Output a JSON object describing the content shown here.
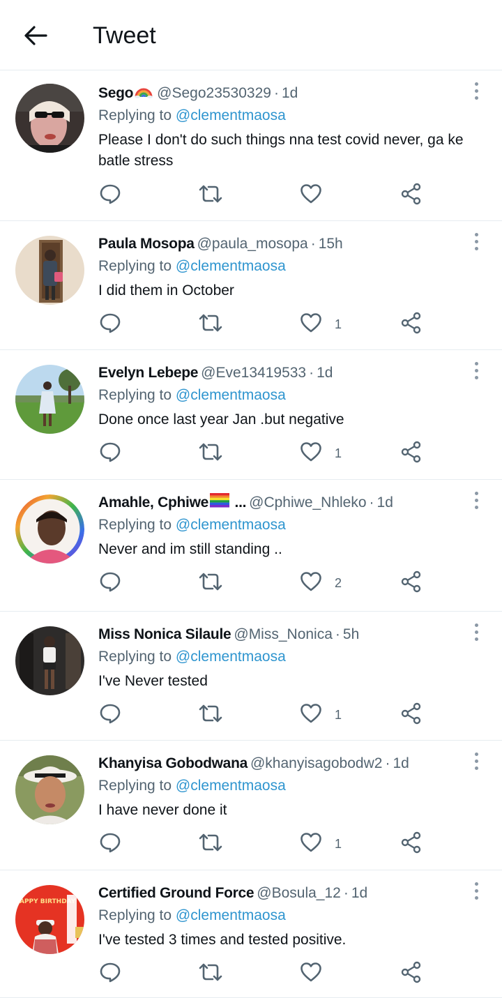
{
  "header": {
    "title": "Tweet"
  },
  "tweets": [
    {
      "name": "Sego",
      "emoji": "rainbow-emoji",
      "handle": "@Sego23530329",
      "time": "1d",
      "replying_prefix": "Replying to ",
      "replying_to": "@clementmaosa",
      "text": "Please I don't do such things nna test covid never, ga ke batle stress",
      "likes": ""
    },
    {
      "name": "Paula Mosopa",
      "emoji": "",
      "handle": "@paula_mosopa",
      "time": "15h",
      "replying_prefix": "Replying to ",
      "replying_to": "@clementmaosa",
      "text": "I did them in October",
      "likes": "1"
    },
    {
      "name": "Evelyn Lebepe",
      "emoji": "",
      "handle": "@Eve13419533",
      "time": "1d",
      "replying_prefix": "Replying to ",
      "replying_to": "@clementmaosa",
      "text": "Done once last year Jan .but negative",
      "likes": "1"
    },
    {
      "name": "Amahle, Cphiwe",
      "emoji": "rainbow-flag-emoji",
      "name_suffix": " ...",
      "handle": "@Cphiwe_Nhleko",
      "time": "1d",
      "replying_prefix": "Replying to ",
      "replying_to": "@clementmaosa",
      "text": "Never and im still standing ..",
      "likes": "2"
    },
    {
      "name": "Miss Nonica Silaule",
      "emoji": "",
      "handle": "@Miss_Nonica",
      "time": "5h",
      "replying_prefix": "Replying to ",
      "replying_to": "@clementmaosa",
      "text": "I've Never tested",
      "likes": "1"
    },
    {
      "name": "Khanyisa Gobodwana",
      "emoji": "",
      "handle": "@khanyisagobodw2",
      "time": "1d",
      "replying_prefix": "Replying to ",
      "replying_to": "@clementmaosa",
      "text": "I have never done it",
      "likes": "1"
    },
    {
      "name": "Certified Ground Force",
      "emoji": "",
      "handle": "@Bosula_12",
      "time": "1d",
      "replying_prefix": "Replying to ",
      "replying_to": "@clementmaosa",
      "text": "I've tested 3 times and tested positive.",
      "likes": ""
    }
  ],
  "icons": {
    "back": "arrow-left-icon",
    "reply": "reply-icon",
    "retweet": "retweet-icon",
    "like": "heart-icon",
    "share": "share-icon",
    "more": "more-vertical-icon"
  },
  "colors": {
    "mention": "#2f95cf",
    "muted": "#536471",
    "divider": "#e6ecf0"
  }
}
